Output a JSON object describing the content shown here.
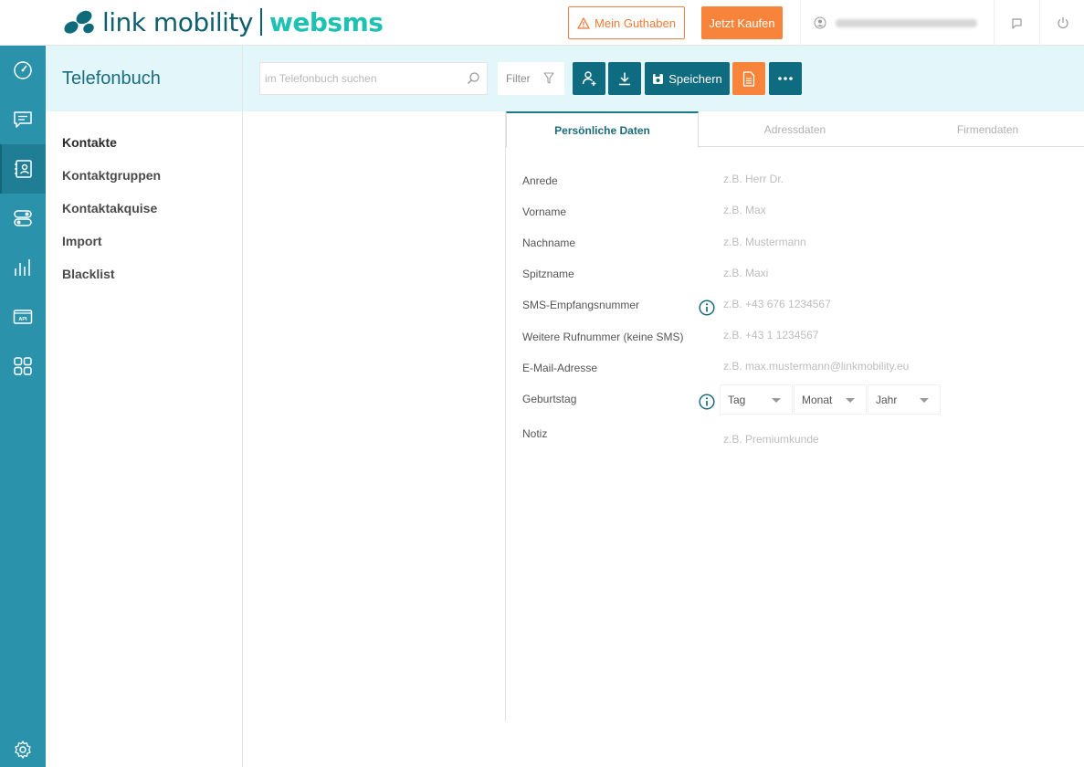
{
  "header": {
    "logo_text1": "link mobility",
    "logo_text2": "websms",
    "guthaben_label": "Mein Guthaben",
    "kaufen_label": "Jetzt Kaufen",
    "colors": {
      "accent": "#0f6b7f",
      "orange": "#f7843a",
      "teal_light": "#1fc1b3"
    }
  },
  "rail": {
    "items": [
      {
        "icon": "dashboard-icon"
      },
      {
        "icon": "message-icon"
      },
      {
        "icon": "contacts-icon",
        "active": true
      },
      {
        "icon": "toggles-icon"
      },
      {
        "icon": "statistics-icon"
      },
      {
        "icon": "api-icon"
      },
      {
        "icon": "apps-grid-icon"
      },
      {
        "icon": "settings-gear-icon"
      }
    ],
    "api_label": "API"
  },
  "sidebar": {
    "title": "Telefonbuch",
    "items": [
      {
        "label": "Kontakte"
      },
      {
        "label": "Kontaktgruppen"
      },
      {
        "label": "Kontaktakquise"
      },
      {
        "label": "Import"
      },
      {
        "label": "Blacklist"
      }
    ]
  },
  "toolbar": {
    "search_placeholder": "im Telefonbuch suchen",
    "filter_label": "Filter",
    "save_label": "Speichern"
  },
  "tabs": [
    {
      "label": "Persönliche Daten"
    },
    {
      "label": "Adressdaten"
    },
    {
      "label": "Firmendaten"
    }
  ],
  "form": {
    "fields": [
      {
        "label": "Anrede",
        "placeholder": "z.B. Herr Dr."
      },
      {
        "label": "Vorname",
        "placeholder": "z.B. Max"
      },
      {
        "label": "Nachname",
        "placeholder": "z.B. Mustermann"
      },
      {
        "label": "Spitzname",
        "placeholder": "z.B. Maxi"
      },
      {
        "label": "SMS-Empfangsnummer",
        "placeholder": "z.B. +43 676 1234567"
      },
      {
        "label": "Weitere Rufnummer (keine SMS)",
        "placeholder": "z.B. +43 1 1234567"
      },
      {
        "label": "E-Mail-Adresse",
        "placeholder": "z.B. max.mustermann@linkmobility.eu"
      },
      {
        "label": "Geburtstag"
      },
      {
        "label": "Notiz",
        "placeholder": "z.B. Premiumkunde"
      }
    ],
    "birthday": {
      "day": "Tag",
      "month": "Monat",
      "year": "Jahr"
    }
  }
}
